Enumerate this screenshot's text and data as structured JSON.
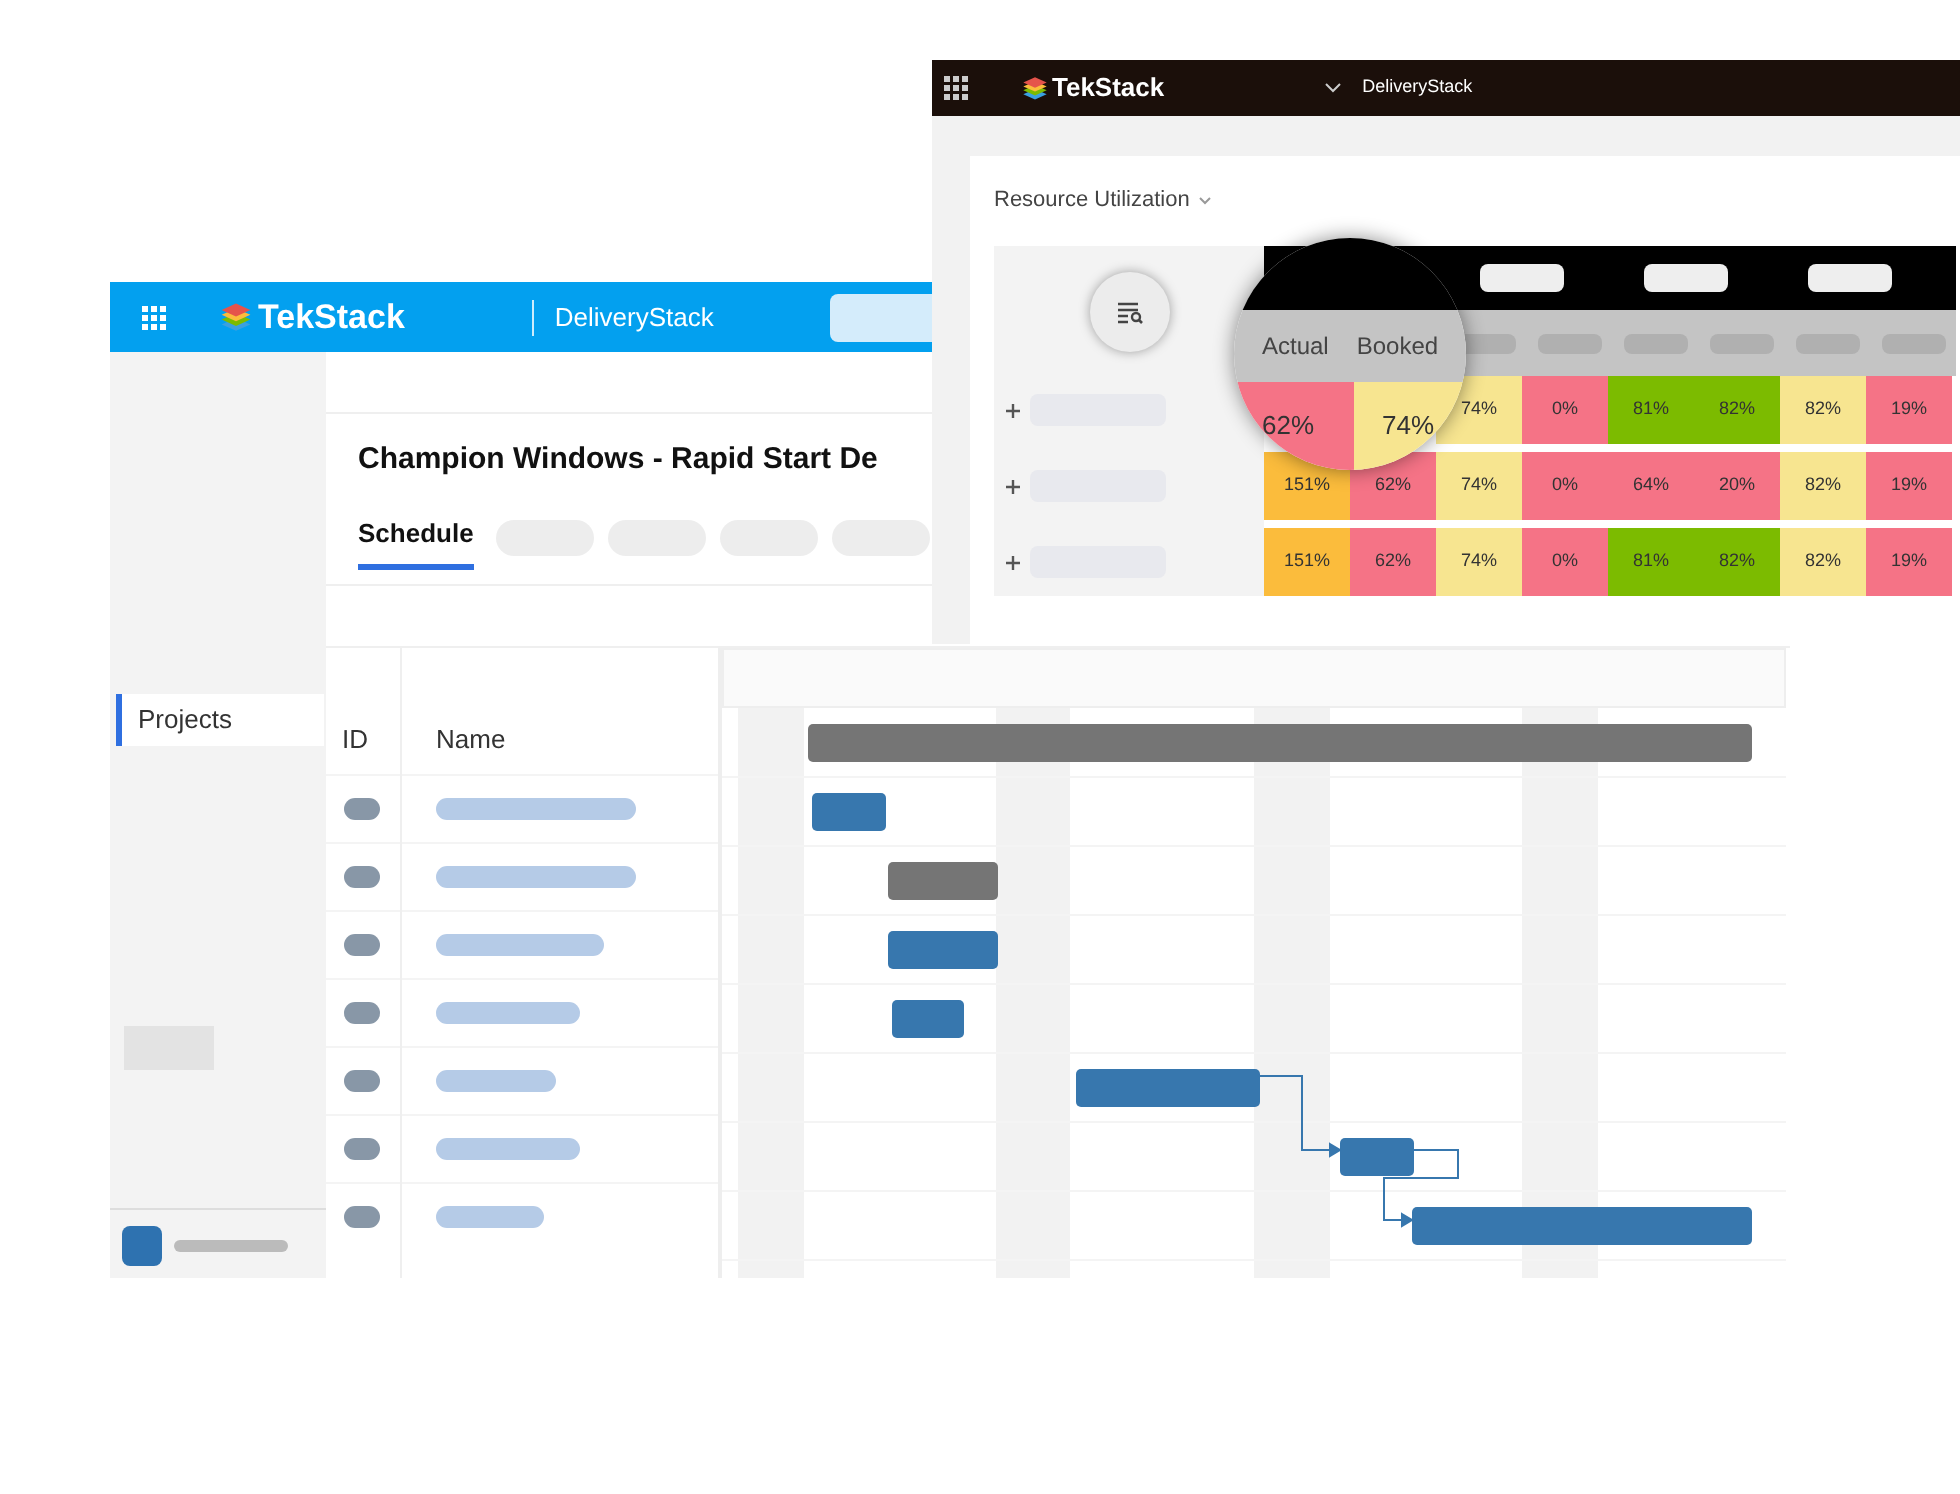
{
  "schedule_window": {
    "header": {
      "logo": "TekStack",
      "app": "DeliveryStack"
    },
    "sidebar": {
      "items": [
        {
          "label": "Projects",
          "selected": true
        }
      ]
    },
    "project_title": "Champion Windows - Rapid Start De",
    "tabs": [
      {
        "label": "Schedule",
        "selected": true
      }
    ],
    "table": {
      "columns": [
        "ID",
        "Name"
      ]
    }
  },
  "resource_window": {
    "header": {
      "logo": "TekStack",
      "app": "DeliveryStack"
    },
    "title": "Resource Utilization",
    "magnifier": {
      "columns": [
        "Actual",
        "Booked"
      ],
      "cells": [
        {
          "value": "62%",
          "color": "#f57386"
        },
        {
          "value": "74%",
          "color": "#f7e590"
        }
      ]
    },
    "rows": [
      {
        "cells": [
          {},
          {},
          {
            "value": "74%",
            "color": "#f7e590"
          },
          {
            "value": "0%",
            "color": "#f57386"
          },
          {
            "value": "81%",
            "color": "#7cbb00"
          },
          {
            "value": "82%",
            "color": "#7cbb00"
          },
          {
            "value": "82%",
            "color": "#f7e590"
          },
          {
            "value": "19%",
            "color": "#f57386"
          }
        ]
      },
      {
        "cells": [
          {
            "value": "151%",
            "color": "#fbbc3c"
          },
          {
            "value": "62%",
            "color": "#f57386"
          },
          {
            "value": "74%",
            "color": "#f7e590"
          },
          {
            "value": "0%",
            "color": "#f57386"
          },
          {
            "value": "64%",
            "color": "#f57386"
          },
          {
            "value": "20%",
            "color": "#f57386"
          },
          {
            "value": "82%",
            "color": "#f7e590"
          },
          {
            "value": "19%",
            "color": "#f57386"
          }
        ]
      },
      {
        "cells": [
          {
            "value": "151%",
            "color": "#fbbc3c"
          },
          {
            "value": "62%",
            "color": "#f57386"
          },
          {
            "value": "74%",
            "color": "#f7e590"
          },
          {
            "value": "0%",
            "color": "#f57386"
          },
          {
            "value": "81%",
            "color": "#7cbb00"
          },
          {
            "value": "82%",
            "color": "#7cbb00"
          },
          {
            "value": "82%",
            "color": "#f7e590"
          },
          {
            "value": "19%",
            "color": "#f57386"
          }
        ]
      }
    ]
  }
}
